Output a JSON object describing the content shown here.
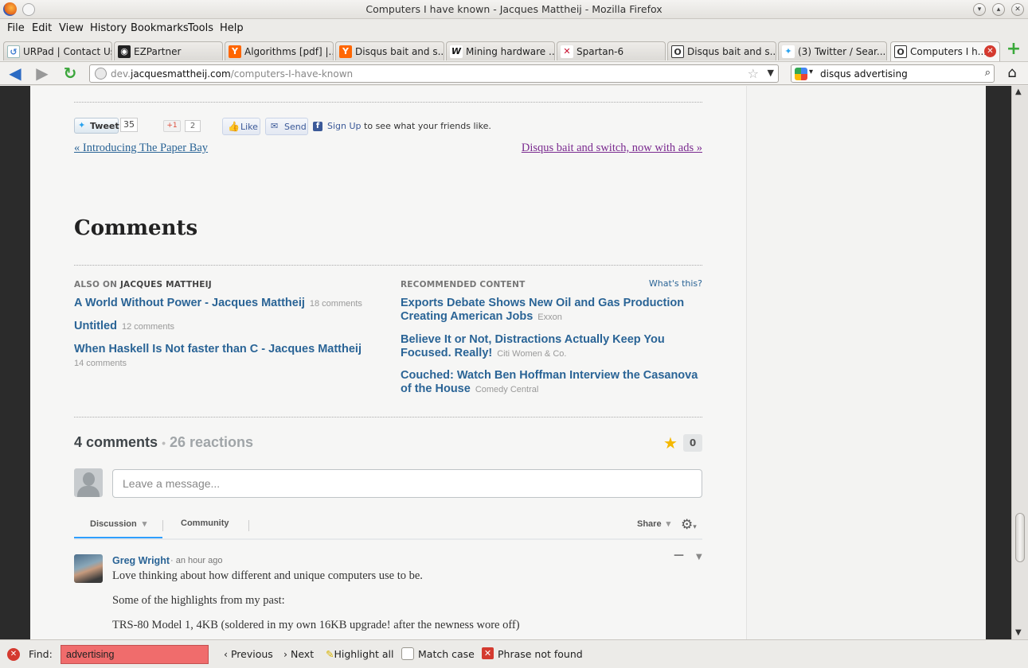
{
  "window": {
    "title": "Computers I have known - Jacques Mattheij - Mozilla Firefox"
  },
  "menu": [
    "File",
    "Edit",
    "View",
    "History",
    "Bookmarks",
    "Tools",
    "Help"
  ],
  "tabs": [
    {
      "label": "URPad | Contact Us",
      "icon": "urpad-icon",
      "icon_color": "#3d7bd0"
    },
    {
      "label": "EZPartner",
      "icon": "ezpartner-icon",
      "icon_color": "#222222"
    },
    {
      "label": "Algorithms [pdf] |...",
      "icon": "ycombinator-icon",
      "icon_color": "#ff6600"
    },
    {
      "label": "Disqus bait and s...",
      "icon": "ycombinator-icon",
      "icon_color": "#ff6600"
    },
    {
      "label": "Mining hardware ...",
      "icon": "bitcoin-wiki-icon",
      "icon_color": "#ffffff"
    },
    {
      "label": "Spartan-6",
      "icon": "xilinx-icon",
      "icon_color": "#c8102e"
    },
    {
      "label": "Disqus bait and s...",
      "icon": "site-o-icon",
      "icon_color": "#333333"
    },
    {
      "label": "(3) Twitter / Sear...",
      "icon": "twitter-icon",
      "icon_color": "#2aa3ef"
    },
    {
      "label": "Computers I h...",
      "icon": "site-o-icon",
      "icon_color": "#333333",
      "active": true
    }
  ],
  "nav": {
    "url_prefix": "dev.",
    "url_domain": "jacquesmattheij.com",
    "url_path": "/computers-I-have-known",
    "search_value": "disqus advertising"
  },
  "share": {
    "tweet_label": "Tweet",
    "tweet_count": "35",
    "gplus_label": "+1",
    "gplus_count": "2",
    "like_label": "Like",
    "send_label": "Send",
    "signup_link": "Sign Up",
    "signup_text": "to see what your friends like."
  },
  "postnav": {
    "prev": "« Introducing The Paper Bay",
    "next": "Disqus bait and switch, now with ads »"
  },
  "comments_heading": "Comments",
  "also_on": {
    "prefix": "ALSO ON",
    "site": "JACQUES MATTHEIJ",
    "items": [
      {
        "title": "A World Without Power - Jacques Mattheij",
        "meta": "18 comments"
      },
      {
        "title": "Untitled",
        "meta": "12 comments"
      },
      {
        "title": "When Haskell Is Not faster than C - Jacques Mattheij",
        "meta": "14 comments"
      }
    ]
  },
  "recommended": {
    "heading": "RECOMMENDED CONTENT",
    "whats_this": "What's this?",
    "items": [
      {
        "line1": "Exports Debate Shows New Oil and Gas Production",
        "line2": "Creating American Jobs",
        "meta": "Exxon"
      },
      {
        "line1": "Believe It or Not, Distractions Actually Keep You",
        "line2": "Focused. Really!",
        "meta": "Citi Women & Co."
      },
      {
        "line1": "Couched: Watch Ben Hoffman Interview the Casanova",
        "line2": "of the House",
        "meta": "Comedy Central"
      }
    ]
  },
  "discussion": {
    "comment_count": "4 comments",
    "separator": "•",
    "reactions": "26 reactions",
    "star_count": "0",
    "message_placeholder": "Leave a message...",
    "tab_discussion": "Discussion",
    "tab_community": "Community",
    "share_label": "Share",
    "caret": "▾"
  },
  "comment": {
    "author": "Greg Wright",
    "time": "· an hour ago",
    "paragraphs": [
      "Love thinking about how different and unique computers use to be.",
      "Some of the highlights from my past:",
      "TRS-80 Model 1, 4KB (soldered in my own 16KB upgrade! after the newness wore off)"
    ]
  },
  "findbar": {
    "label": "Find:",
    "value": "advertising",
    "previous": "Previous",
    "next": "Next",
    "highlight_all": "Highlight all",
    "match_case": "Match case",
    "status": "Phrase not found"
  }
}
